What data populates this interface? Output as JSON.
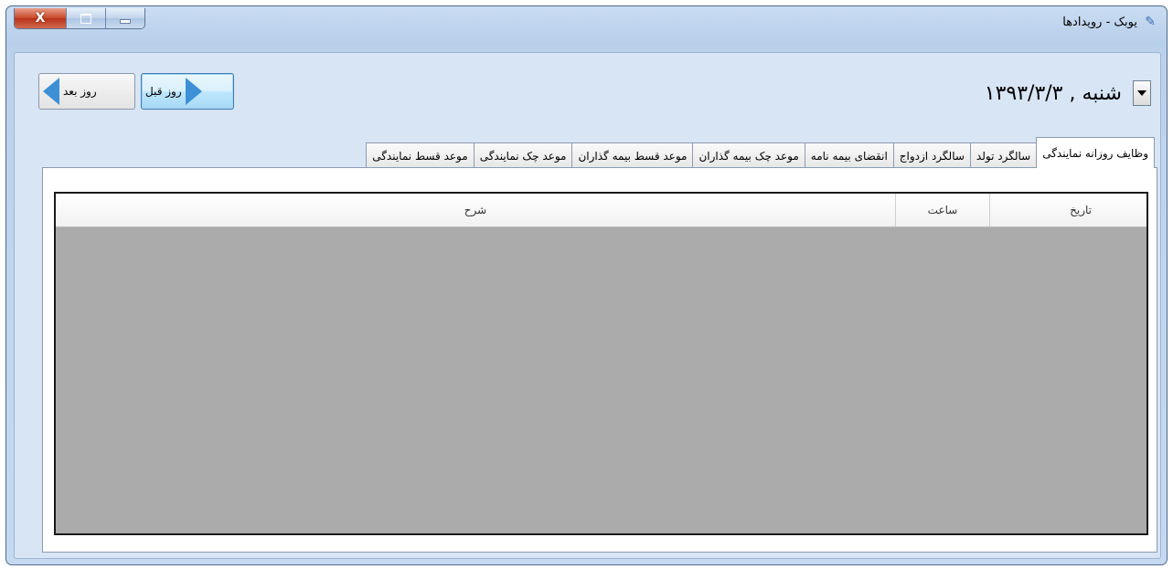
{
  "window": {
    "title": "یوبک - رویدادها",
    "icon": "app-logo-icon",
    "controls": {
      "close": "X"
    }
  },
  "navigation": {
    "prev_label": "روز قبل",
    "next_label": "روز بعد"
  },
  "date_selector": {
    "value": "شنبه , ۱۳۹۳/۳/۳"
  },
  "tabs": [
    {
      "label": "وظایف روزانه نمایندگی",
      "active": true
    },
    {
      "label": "سالگرد تولد",
      "active": false
    },
    {
      "label": "سالگرد ازدواج",
      "active": false
    },
    {
      "label": "انقضای بیمه نامه",
      "active": false
    },
    {
      "label": "موعد چک بیمه گذاران",
      "active": false
    },
    {
      "label": "موعد قسط بیمه گذاران",
      "active": false
    },
    {
      "label": "موعد چک نمایندگی",
      "active": false
    },
    {
      "label": "موعد قسط نمایندگی",
      "active": false
    }
  ],
  "grid": {
    "columns": [
      "تاریخ",
      "ساعت",
      "شرح"
    ],
    "rows": []
  },
  "colors": {
    "window_frame": "#c5d9f1",
    "grid_empty": "#ababab",
    "close_button": "#c7472b",
    "arrow": "#3d8fd6"
  }
}
